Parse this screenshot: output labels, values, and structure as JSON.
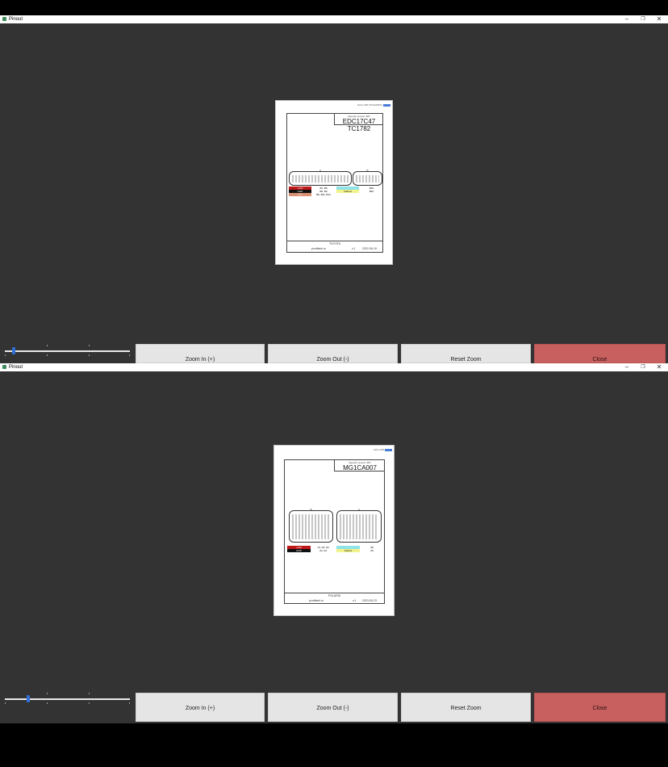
{
  "windows": [
    {
      "title": "Pinout",
      "document": {
        "header_small": "Задний разъем ЭБУ",
        "ecu_title": "EDC17C47 TC1782",
        "brand_tag": "МАССИВ ПРОШИВОК",
        "connector_left_label": "A",
        "connector_right_label": "B",
        "legend": {
          "plus12_label": "+12V",
          "gnd_label": "GND",
          "extra_label": "K-L",
          "can_label": "CAN-H",
          "pin_values": [
            "B1, B5",
            "B2, B3",
            "B6, B11, B13",
            "B22",
            "B16"
          ]
        },
        "footer_brand": "TOYOTA",
        "footer_site": "pcmflash.ru",
        "footer_version": "v.1",
        "footer_date": "2022-06-15"
      },
      "zoom_slider": {
        "value_fraction": 0.06
      },
      "buttons": {
        "zoom_in": "Zoom In (+)",
        "zoom_out": "Zoom Out (-)",
        "reset": "Reset Zoom",
        "close": "Close"
      },
      "colors": {
        "close": "#c96060",
        "slider_thumb": "#2f6fd6"
      }
    },
    {
      "title": "Pinout",
      "document": {
        "header_small": "Задний разъем ЭБУ",
        "ecu_title": "MG1CA007",
        "brand_tag": "МАССИВ",
        "connector_left_label": "B",
        "connector_right_label": "A",
        "legend": {
          "plus12_label": "+12V",
          "gnd_label": "GND",
          "can_label": "CAN-H",
          "pin_values": [
            "A1, A5, A6",
            "A2, A3",
            "A8",
            "A9"
          ]
        },
        "footer_brand": "POLARIS",
        "footer_site": "pcmflash.ru",
        "footer_version": "v.1",
        "footer_date": "2023-05-23"
      },
      "zoom_slider": {
        "value_fraction": 0.18
      },
      "buttons": {
        "zoom_in": "Zoom In (+)",
        "zoom_out": "Zoom Out (-)",
        "reset": "Reset Zoom",
        "close": "Close"
      },
      "colors": {
        "close": "#c96060",
        "slider_thumb": "#2f6fd6"
      }
    }
  ]
}
